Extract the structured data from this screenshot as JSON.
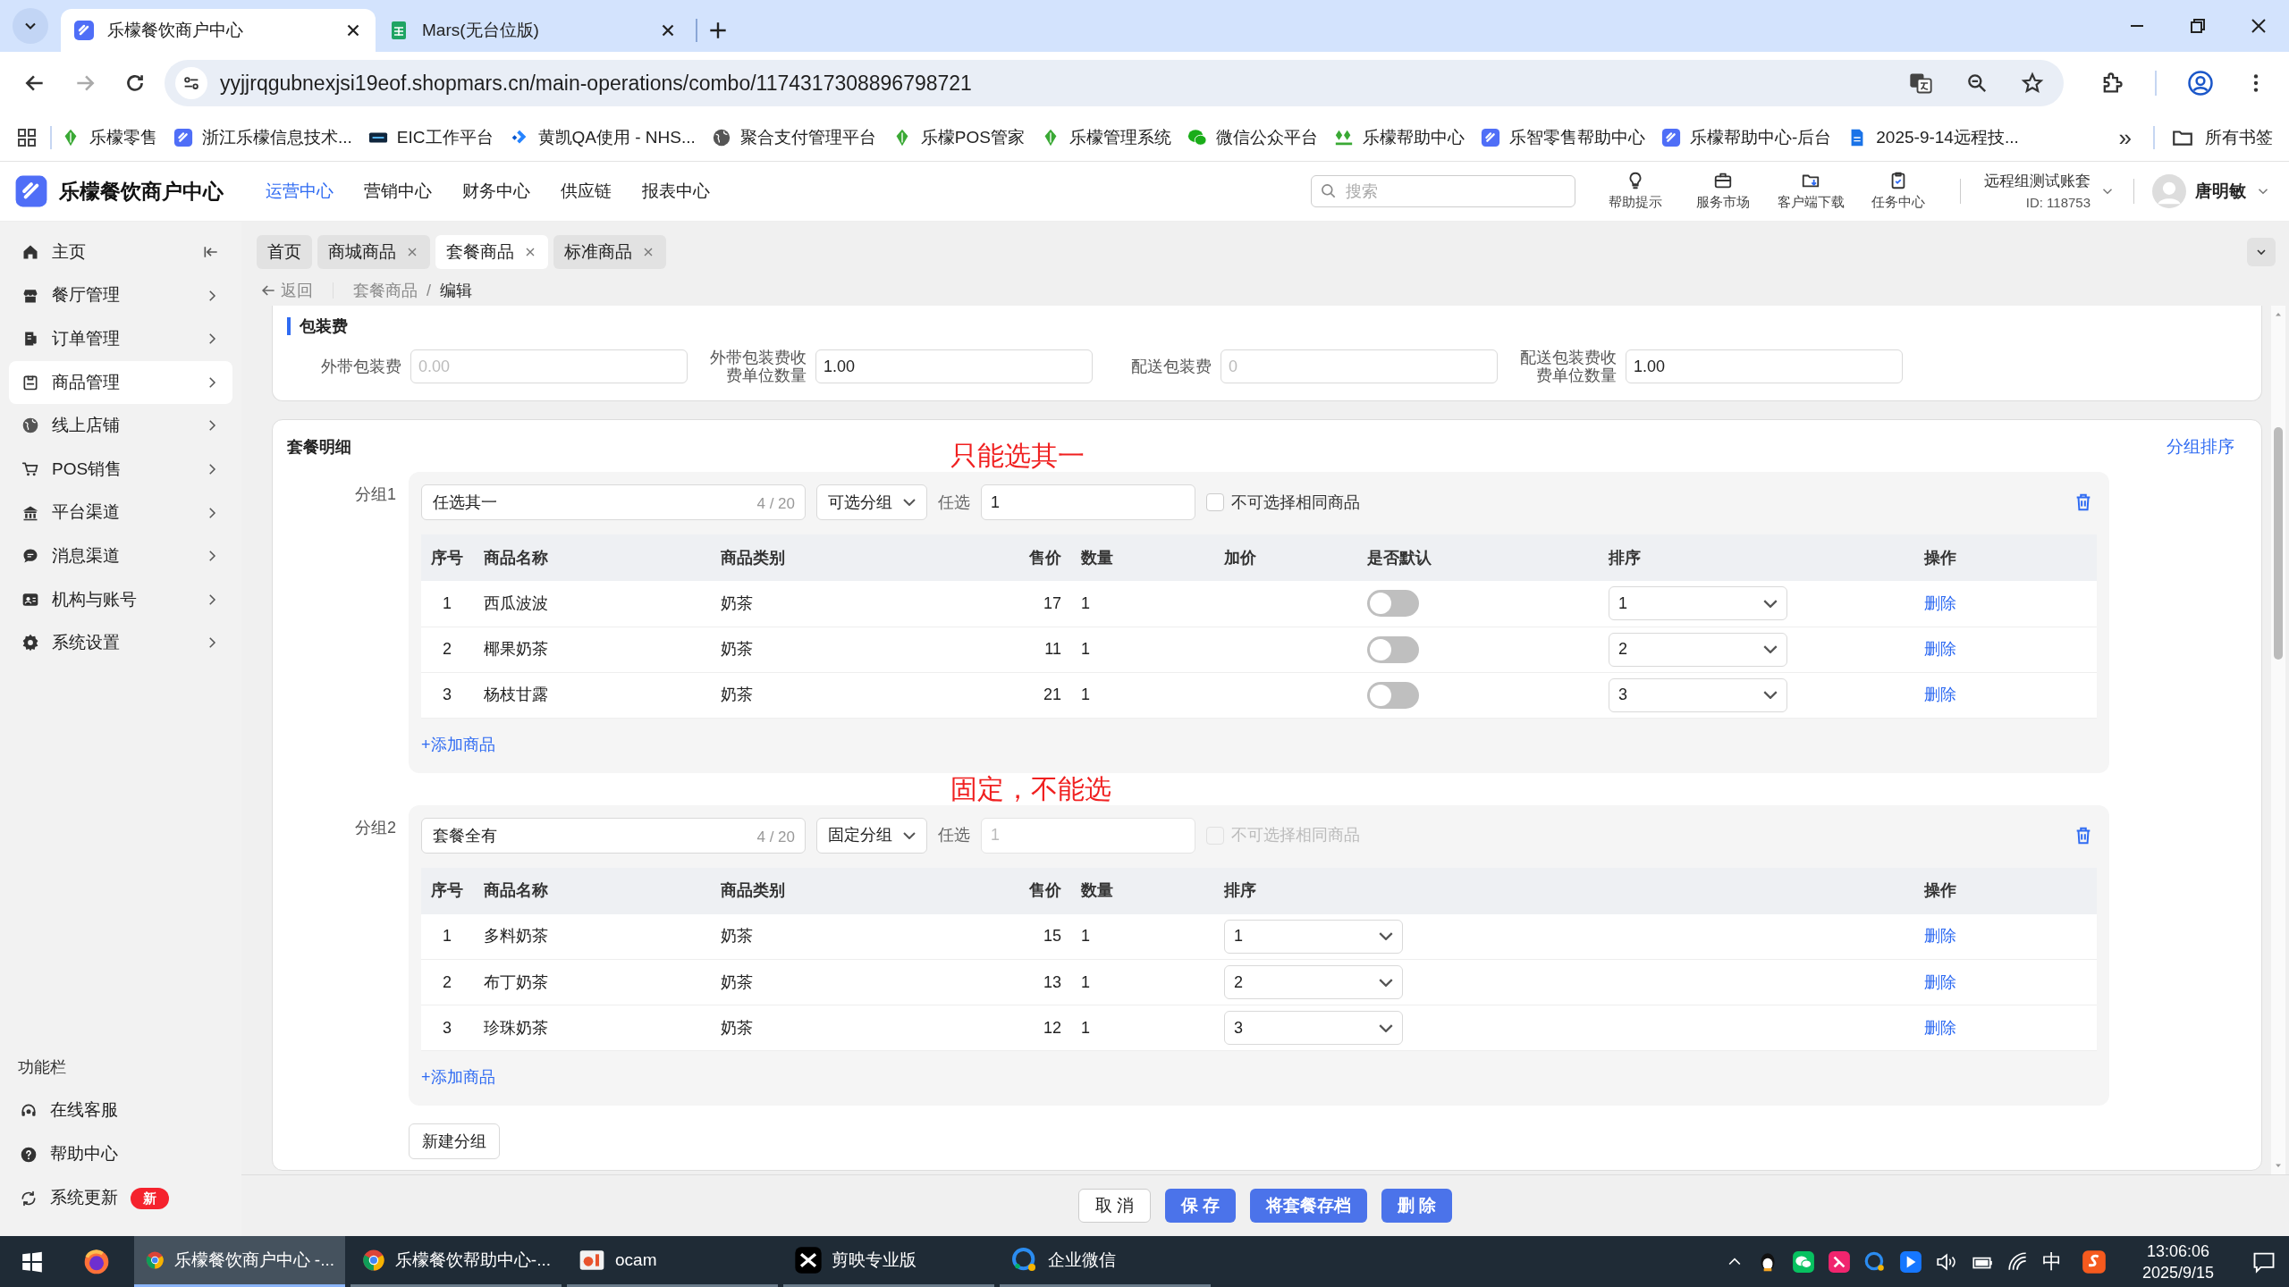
{
  "browser": {
    "tabs": [
      {
        "title": "乐檬餐饮商户中心",
        "selected": true,
        "kind": "app"
      },
      {
        "title": "Mars(无台位版)",
        "selected": false,
        "kind": "sheet"
      }
    ],
    "url": "yyjjrqgubnexjsi19eof.shopmars.cn/main-operations/combo/1174317308896798721",
    "bookmarks": [
      {
        "label": "乐檬零售",
        "kind": "leaf"
      },
      {
        "label": "浙江乐檬信息技术...",
        "kind": "app"
      },
      {
        "label": "EIC工作平台",
        "kind": "eic"
      },
      {
        "label": "黄凯QA使用 - NHS...",
        "kind": "jira"
      },
      {
        "label": "聚合支付管理平台",
        "kind": "globe"
      },
      {
        "label": "乐檬POS管家",
        "kind": "leaf"
      },
      {
        "label": "乐檬管理系统",
        "kind": "leaf"
      },
      {
        "label": "微信公众平台",
        "kind": "wechat"
      },
      {
        "label": "乐檬帮助中心",
        "kind": "lemon"
      },
      {
        "label": "乐智零售帮助中心",
        "kind": "app"
      },
      {
        "label": "乐檬帮助中心-后台",
        "kind": "app"
      },
      {
        "label": "2025-9-14远程技...",
        "kind": "doc"
      }
    ],
    "more": "»",
    "all_bookmarks": "所有书签"
  },
  "app": {
    "title": "乐檬餐饮商户中心",
    "nav": [
      {
        "label": "运营中心",
        "selected": true
      },
      {
        "label": "营销中心",
        "selected": false
      },
      {
        "label": "财务中心",
        "selected": false
      },
      {
        "label": "供应链",
        "selected": false
      },
      {
        "label": "报表中心",
        "selected": false
      }
    ],
    "search_placeholder": "搜索",
    "tools": [
      {
        "label": "帮助提示",
        "kind": "bulb"
      },
      {
        "label": "服务市场",
        "kind": "bag"
      },
      {
        "label": "客户端下载",
        "kind": "folder"
      },
      {
        "label": "任务中心",
        "kind": "clipboard"
      }
    ],
    "account": "远程组测试账套",
    "account_id": "ID: 118753",
    "user": "唐明敏"
  },
  "sidebar": {
    "items": [
      {
        "label": "主页",
        "kind": "home",
        "selected": false
      },
      {
        "label": "餐厅管理",
        "kind": "store",
        "selected": false
      },
      {
        "label": "订单管理",
        "kind": "order",
        "selected": false
      },
      {
        "label": "商品管理",
        "kind": "goods",
        "selected": true
      },
      {
        "label": "线上店铺",
        "kind": "globe",
        "selected": false
      },
      {
        "label": "POS销售",
        "kind": "cart",
        "selected": false
      },
      {
        "label": "平台渠道",
        "kind": "bank",
        "selected": false
      },
      {
        "label": "消息渠道",
        "kind": "chat",
        "selected": false
      },
      {
        "label": "机构与账号",
        "kind": "id",
        "selected": false
      },
      {
        "label": "系统设置",
        "kind": "gear",
        "selected": false
      }
    ],
    "function_title": "功能栏",
    "function_items": [
      {
        "label": "在线客服",
        "kind": "headset"
      },
      {
        "label": "帮助中心",
        "kind": "help"
      },
      {
        "label": "系统更新",
        "kind": "refresh",
        "badge": "新"
      }
    ]
  },
  "page_tabs": [
    {
      "label": "首页",
      "selected": false,
      "closable": false
    },
    {
      "label": "商城商品",
      "selected": false,
      "closable": true
    },
    {
      "label": "套餐商品",
      "selected": true,
      "closable": true
    },
    {
      "label": "标准商品",
      "selected": false,
      "closable": true
    }
  ],
  "breadcrumb": {
    "back": "返回",
    "path": [
      "套餐商品",
      "编辑"
    ],
    "separator": "/"
  },
  "packaging": {
    "title": "包装费",
    "fields": [
      {
        "label": "外带包装费",
        "placeholder": "0.00"
      },
      {
        "label": "外带包装费收费单位数量",
        "value": "1.00"
      },
      {
        "label": "配送包装费",
        "placeholder": "0"
      },
      {
        "label": "配送包装费收费单位数量",
        "value": "1.00"
      }
    ]
  },
  "combo": {
    "title": "套餐明细",
    "sort_link": "分组排序",
    "groups": [
      {
        "label": "分组1",
        "annotation": "只能选其一",
        "name": "任选其一",
        "counter": "4 / 20",
        "type": "可选分组",
        "pick_label": "任选",
        "pick_value": "1",
        "locked": false,
        "same_item": {
          "label": "不可选择相同商品",
          "checked": false
        },
        "columns": [
          {
            "label": "序号",
            "kind": "index"
          },
          {
            "label": "商品名称",
            "kind": "name"
          },
          {
            "label": "商品类别",
            "kind": "category"
          },
          {
            "label": "售价",
            "kind": "price"
          },
          {
            "label": "数量",
            "kind": "qty"
          },
          {
            "label": "加价",
            "kind": "markup"
          },
          {
            "label": "是否默认",
            "kind": "default"
          },
          {
            "label": "排序",
            "kind": "sort"
          },
          {
            "label": "操作",
            "kind": "action"
          }
        ],
        "rows": [
          {
            "index": "1",
            "name": "西瓜波波",
            "category": "奶茶",
            "price": "17",
            "qty": "1",
            "default": false,
            "sort": "1",
            "action": "删除"
          },
          {
            "index": "2",
            "name": "椰果奶茶",
            "category": "奶茶",
            "price": "11",
            "qty": "1",
            "default": false,
            "sort": "2",
            "action": "删除"
          },
          {
            "index": "3",
            "name": "杨枝甘露",
            "category": "奶茶",
            "price": "21",
            "qty": "1",
            "default": false,
            "sort": "3",
            "action": "删除"
          }
        ],
        "add": "+添加商品"
      },
      {
        "label": "分组2",
        "annotation": "固定，不能选",
        "name": "套餐全有",
        "counter": "4 / 20",
        "type": "固定分组",
        "pick_label": "任选",
        "pick_value": "1",
        "locked": true,
        "same_item": {
          "label": "不可选择相同商品",
          "checked": false
        },
        "columns": [
          {
            "label": "序号",
            "kind": "index"
          },
          {
            "label": "商品名称",
            "kind": "name"
          },
          {
            "label": "商品类别",
            "kind": "category"
          },
          {
            "label": "售价",
            "kind": "price"
          },
          {
            "label": "数量",
            "kind": "qty"
          },
          {
            "label": "排序",
            "kind": "sort"
          },
          {
            "label": "操作",
            "kind": "action"
          }
        ],
        "rows": [
          {
            "index": "1",
            "name": "多料奶茶",
            "category": "奶茶",
            "price": "15",
            "qty": "1",
            "sort": "1",
            "action": "删除"
          },
          {
            "index": "2",
            "name": "布丁奶茶",
            "category": "奶茶",
            "price": "13",
            "qty": "1",
            "sort": "2",
            "action": "删除"
          },
          {
            "index": "3",
            "name": "珍珠奶茶",
            "category": "奶茶",
            "price": "12",
            "qty": "1",
            "sort": "3",
            "action": "删除"
          }
        ],
        "add": "+添加商品"
      }
    ],
    "new_group": "新建分组"
  },
  "footer": {
    "buttons": [
      {
        "label": "取 消",
        "kind": "default"
      },
      {
        "label": "保 存",
        "kind": "primary"
      },
      {
        "label": "将套餐存档",
        "kind": "primary"
      },
      {
        "label": "删 除",
        "kind": "primary"
      }
    ]
  },
  "taskbar": {
    "apps": [
      {
        "kind": "firefox",
        "selected": false
      },
      {
        "label": "乐檬餐饮商户中心 -...",
        "kind": "chrome",
        "selected": true
      },
      {
        "label": "乐檬餐饮帮助中心-...",
        "kind": "chrome",
        "selected": false
      },
      {
        "label": "ocam",
        "kind": "ocam",
        "selected": false
      },
      {
        "label": "剪映专业版",
        "kind": "capcut",
        "selected": false
      },
      {
        "label": "企业微信",
        "kind": "wecom",
        "selected": false
      }
    ],
    "ime": "中",
    "time": "13:06:06",
    "date": "2025/9/15"
  }
}
